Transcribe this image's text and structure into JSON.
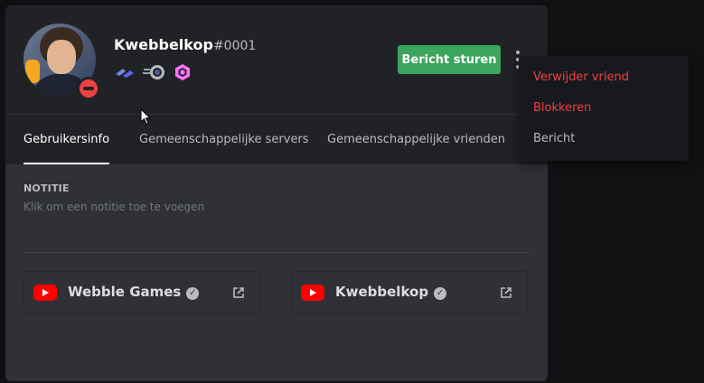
{
  "profile": {
    "username": "Kwebbelkop",
    "discriminator": "#0001",
    "status": "do-not-disturb",
    "badges": [
      "hypesquad-balance-icon",
      "nitro-boost-icon",
      "server-booster-gem-icon"
    ]
  },
  "actions": {
    "send_message": "Bericht sturen"
  },
  "tabs": [
    {
      "label": "Gebruikersinfo",
      "active": true
    },
    {
      "label": "Gemeenschappelijke servers",
      "active": false
    },
    {
      "label": "Gemeenschappelijke vrienden",
      "active": false
    }
  ],
  "note": {
    "title": "NOTITIE",
    "placeholder": "Klik om een notitie toe te voegen"
  },
  "connections": [
    {
      "platform": "youtube",
      "name": "Webble Games",
      "verified": true
    },
    {
      "platform": "youtube",
      "name": "Kwebbelkop",
      "verified": true
    }
  ],
  "context_menu": {
    "items": [
      {
        "label": "Verwijder vriend",
        "variant": "danger"
      },
      {
        "label": "Blokkeren",
        "variant": "danger"
      },
      {
        "label": "Bericht",
        "variant": "normal"
      }
    ]
  },
  "colors": {
    "accent_green": "#3ba55d",
    "danger_red": "#ed4245",
    "youtube_red": "#ff0000",
    "modal_bg": "#2f3136",
    "header_bg": "#202225",
    "menu_bg": "#18191c"
  }
}
